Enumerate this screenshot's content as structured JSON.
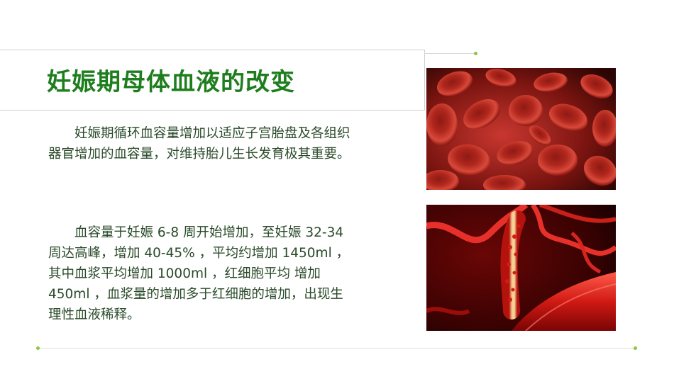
{
  "slide": {
    "title": "妊娠期母体血液的改变",
    "paragraph_1": "妊娠期循环血容量增加以适应子宫胎盘及各组织器官增加的血容量，对维持胎儿生长发育极其重要。",
    "paragraph_2": "血容量于妊娠 6-8 周开始增加，至妊娠 32-34 周达高峰，增加 40-45% ，平均约增加 1450ml ，其中血浆平均增加 1000ml ，红细胞平均  增加 450ml ，血浆量的增加多于红细胞的增加，出现生理性血液稀释。"
  },
  "colors": {
    "title": "#1e7e1e",
    "body_text": "#2a4a2a",
    "accent_dot": "#8cc63f",
    "blood_red": "#c0141a"
  },
  "images": {
    "top": "red-blood-cells-image",
    "bottom": "blood-vessel-image"
  }
}
